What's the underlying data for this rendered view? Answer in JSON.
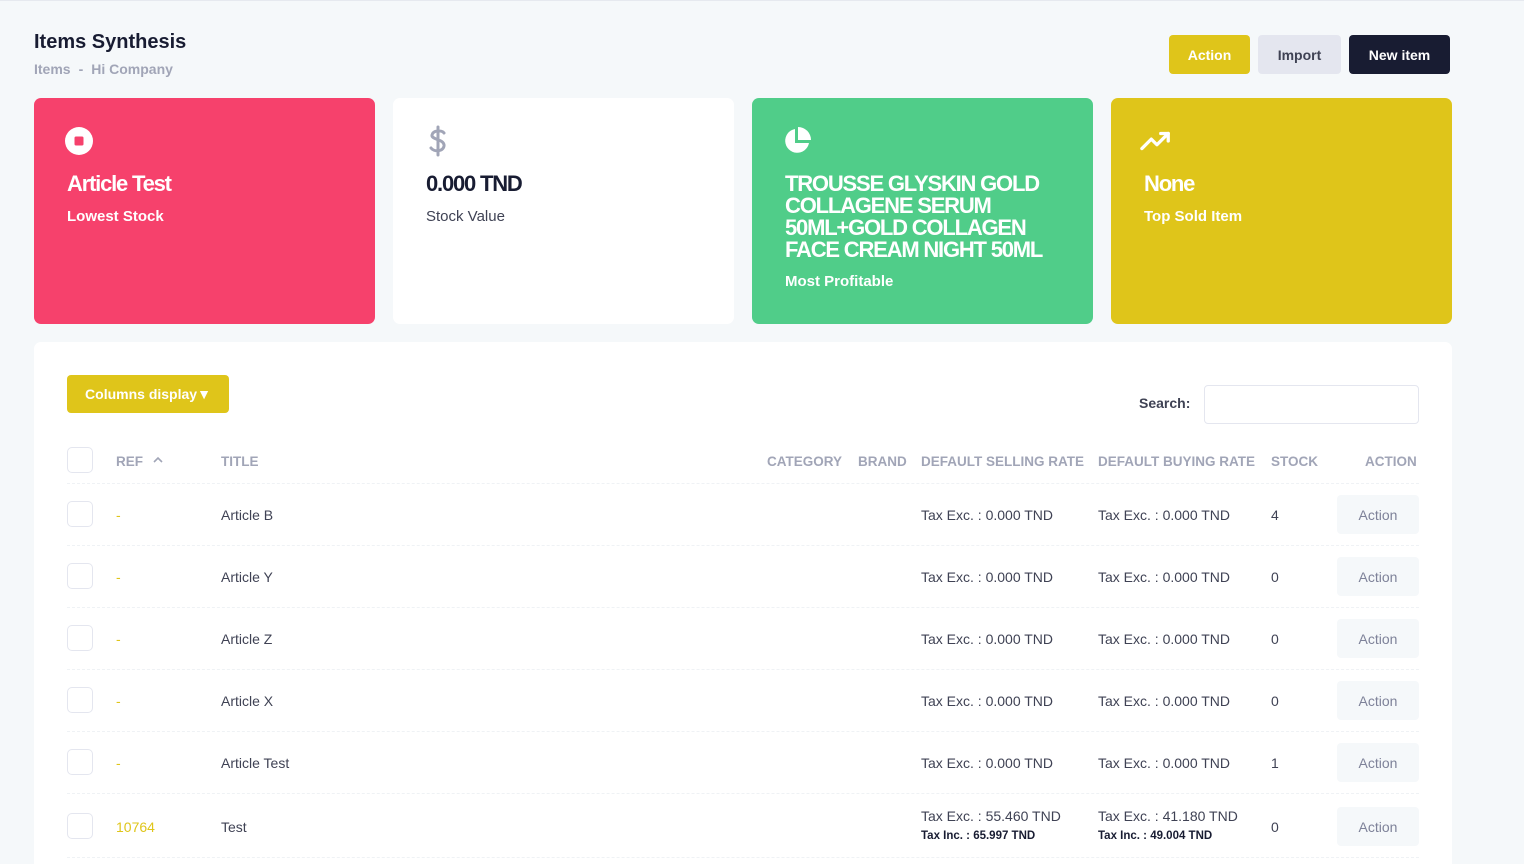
{
  "header": {
    "title": "Items Synthesis",
    "breadcrumb": [
      "Items",
      "-",
      "Hi Company"
    ],
    "buttons": {
      "action": "Action",
      "import": "Import",
      "new_item": "New item"
    }
  },
  "colors": {
    "pink": "#f6416c",
    "green": "#50cd89",
    "yellow": "#dfc51a",
    "dark": "#181c32"
  },
  "stats": [
    {
      "value": "Article Test",
      "label": "Lowest Stock",
      "icon": "stop-circle-icon"
    },
    {
      "value": "0.000 TND",
      "label": "Stock Value",
      "icon": "dollar-icon"
    },
    {
      "value": "TROUSSE GLYSKIN GOLD COLLAGENE SERUM 50ML+GOLD COLLAGEN FACE CREAM NIGHT 50ML",
      "label": "Most Profitable",
      "icon": "pie-chart-icon"
    },
    {
      "value": "None",
      "label": "Top Sold Item",
      "icon": "trending-up-icon"
    }
  ],
  "table": {
    "columns_display_label": "Columns display▼",
    "search_label": "Search:",
    "search_value": "",
    "headers": [
      "REF",
      "TITLE",
      "CATEGORY",
      "BRAND",
      "DEFAULT SELLING RATE",
      "DEFAULT BUYING RATE",
      "STOCK",
      "ACTION"
    ],
    "rows": [
      {
        "ref": "-",
        "title": "Article B",
        "category": "",
        "brand": "",
        "selling": "Tax Exc. : 0.000 TND",
        "selling_inc": "",
        "buying": "Tax Exc. : 0.000 TND",
        "buying_inc": "",
        "stock": "4",
        "action": "Action"
      },
      {
        "ref": "-",
        "title": "Article Y",
        "category": "",
        "brand": "",
        "selling": "Tax Exc. : 0.000 TND",
        "selling_inc": "",
        "buying": "Tax Exc. : 0.000 TND",
        "buying_inc": "",
        "stock": "0",
        "action": "Action"
      },
      {
        "ref": "-",
        "title": "Article Z",
        "category": "",
        "brand": "",
        "selling": "Tax Exc. : 0.000 TND",
        "selling_inc": "",
        "buying": "Tax Exc. : 0.000 TND",
        "buying_inc": "",
        "stock": "0",
        "action": "Action"
      },
      {
        "ref": "-",
        "title": "Article X",
        "category": "",
        "brand": "",
        "selling": "Tax Exc. : 0.000 TND",
        "selling_inc": "",
        "buying": "Tax Exc. : 0.000 TND",
        "buying_inc": "",
        "stock": "0",
        "action": "Action"
      },
      {
        "ref": "-",
        "title": "Article Test",
        "category": "",
        "brand": "",
        "selling": "Tax Exc. : 0.000 TND",
        "selling_inc": "",
        "buying": "Tax Exc. : 0.000 TND",
        "buying_inc": "",
        "stock": "1",
        "action": "Action"
      },
      {
        "ref": "10764",
        "title": "Test",
        "category": "",
        "brand": "",
        "selling": "Tax Exc. : 55.460 TND",
        "selling_inc": "Tax Inc. : 65.997 TND",
        "buying": "Tax Exc. : 41.180 TND",
        "buying_inc": "Tax Inc. : 49.004 TND",
        "stock": "0",
        "action": "Action"
      }
    ]
  }
}
